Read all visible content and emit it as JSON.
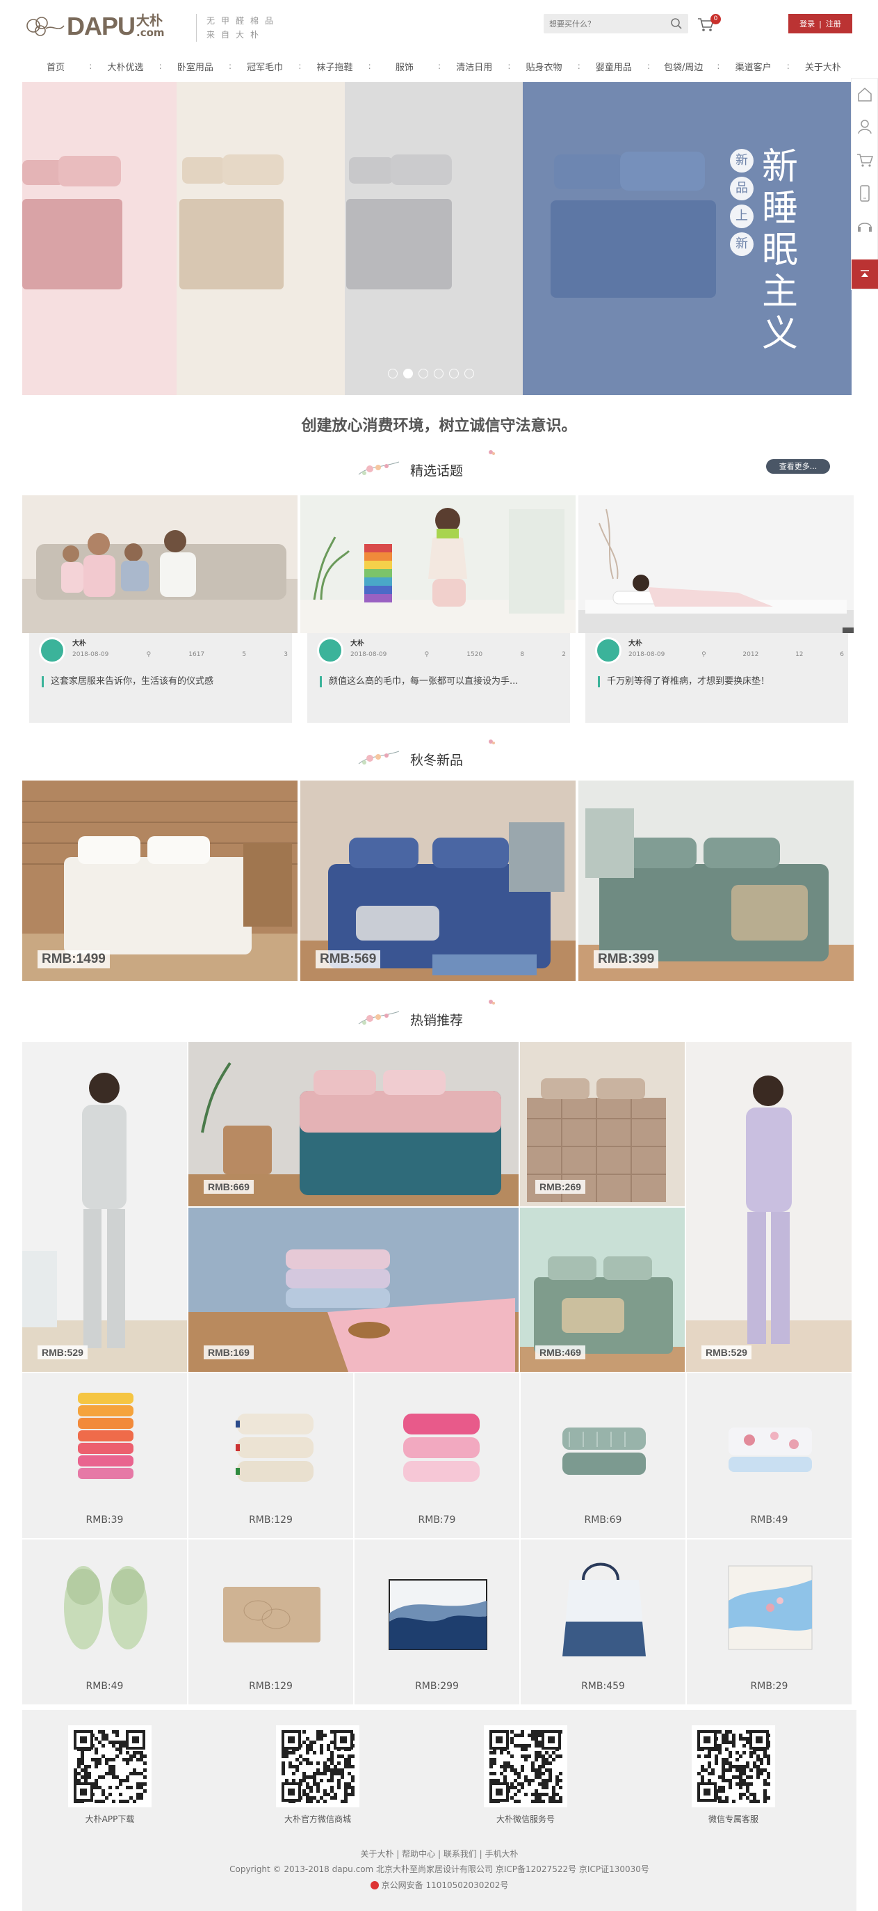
{
  "header": {
    "logo_brand": "DAPU",
    "logo_cn_1": "大朴",
    "logo_cn_2": ".com",
    "slogan_line1": "无甲醛棉品",
    "slogan_line2": "来自大朴",
    "search_placeholder": "想要买什么？",
    "cart_count": "0",
    "login_label": "登录",
    "auth_sep": "|",
    "register_label": "注册"
  },
  "nav": {
    "items": [
      {
        "label": "首页"
      },
      {
        "label": "大朴优选"
      },
      {
        "label": "卧室用品"
      },
      {
        "label": "冠军毛巾"
      },
      {
        "label": "袜子拖鞋"
      },
      {
        "label": "服饰"
      },
      {
        "label": "清洁日用"
      },
      {
        "label": "贴身衣物"
      },
      {
        "label": "婴童用品"
      },
      {
        "label": "包袋/周边"
      },
      {
        "label": "渠道客户"
      },
      {
        "label": "关于大朴"
      }
    ],
    "separator": ":"
  },
  "sidebar": {
    "icons": [
      "home-icon",
      "user-icon",
      "cart-icon",
      "phone-icon",
      "service-icon",
      "back-to-top-icon"
    ]
  },
  "hero": {
    "badge_chars": [
      "新",
      "品",
      "上",
      "新"
    ],
    "title_chars": [
      "新",
      "睡",
      "眠",
      "主",
      "义"
    ],
    "slide_count": 6,
    "active_slide": 2,
    "panel_colors": [
      "#f5dcdc",
      "#efe8df",
      "#dadada",
      "#7389b0"
    ]
  },
  "notice": "创建放心消费环境，树立诚信守法意识。",
  "topics_section": {
    "title": "精选话题",
    "more_label": "查看更多...",
    "items": [
      {
        "author": "大朴",
        "date": "2018-08-09",
        "views": "1617",
        "likes": "5",
        "comments": "3",
        "caption": "这套家居服来告诉你，生活该有的仪式感"
      },
      {
        "author": "大朴",
        "date": "2018-08-09",
        "views": "1520",
        "likes": "8",
        "comments": "2",
        "caption": "颜值这么高的毛巾，每一张都可以直接设为手..."
      },
      {
        "author": "大朴",
        "date": "2018-08-09",
        "views": "2012",
        "likes": "12",
        "comments": "6",
        "caption": "千万别等得了脊椎病，才想到要换床垫！"
      }
    ]
  },
  "new_section": {
    "title": "秋冬新品",
    "items": [
      {
        "price": "RMB:1499"
      },
      {
        "price": "RMB:569"
      },
      {
        "price": "RMB:399"
      }
    ]
  },
  "hot_section": {
    "title": "热销推荐",
    "big_items": [
      {
        "price": "RMB:529"
      },
      {
        "price": "RMB:669"
      },
      {
        "price": "RMB:269"
      },
      {
        "price": "RMB:529"
      },
      {
        "price": "RMB:169"
      },
      {
        "price": "RMB:469"
      }
    ],
    "small_items": [
      {
        "price": "RMB:39"
      },
      {
        "price": "RMB:129"
      },
      {
        "price": "RMB:79"
      },
      {
        "price": "RMB:69"
      },
      {
        "price": "RMB:49"
      },
      {
        "price": "RMB:49"
      },
      {
        "price": "RMB:129"
      },
      {
        "price": "RMB:299"
      },
      {
        "price": "RMB:459"
      },
      {
        "price": "RMB:29"
      }
    ]
  },
  "footer": {
    "qrs": [
      {
        "label": "大朴APP下载"
      },
      {
        "label": "大朴官方微信商城"
      },
      {
        "label": "大朴微信服务号"
      },
      {
        "label": "微信专属客服"
      }
    ],
    "links": [
      "关于大朴",
      "帮助中心",
      "联系我们",
      "手机大朴"
    ],
    "link_sep": " | ",
    "copyright": "Copyright © 2013-2018 dapu.com 北京大朴至尚家居设计有限公司 京ICP备12027522号 京ICP证130030号",
    "police": "京公网安备 11010502030202号"
  }
}
